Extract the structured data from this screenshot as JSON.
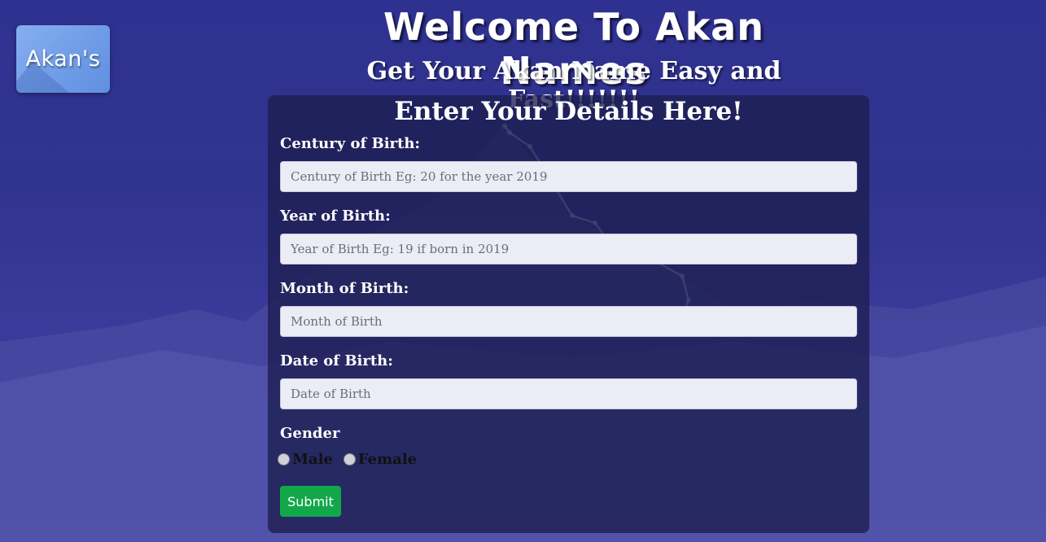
{
  "header": {
    "logo_text": "Akan's",
    "title": "Welcome To Akan Names",
    "subtitle": "Get Your Akan Name Easy and Fast!!!!!!!"
  },
  "form": {
    "title": "Enter Your Details Here!",
    "century": {
      "label": "Century of Birth:",
      "placeholder": "Century of Birth Eg: 20 for the year 2019",
      "value": ""
    },
    "year": {
      "label": "Year of Birth:",
      "placeholder": "Year of Birth Eg: 19 if born in 2019",
      "value": ""
    },
    "month": {
      "label": "Month of Birth:",
      "placeholder": "Month of Birth",
      "value": ""
    },
    "date": {
      "label": "Date of Birth:",
      "placeholder": "Date of Birth",
      "value": ""
    },
    "gender": {
      "label": "Gender",
      "options": [
        "Male",
        "Female"
      ]
    },
    "submit_label": "Submit"
  },
  "colors": {
    "background": "#31348f",
    "submit": "#12a84a",
    "logo": "#6f9ce6"
  }
}
